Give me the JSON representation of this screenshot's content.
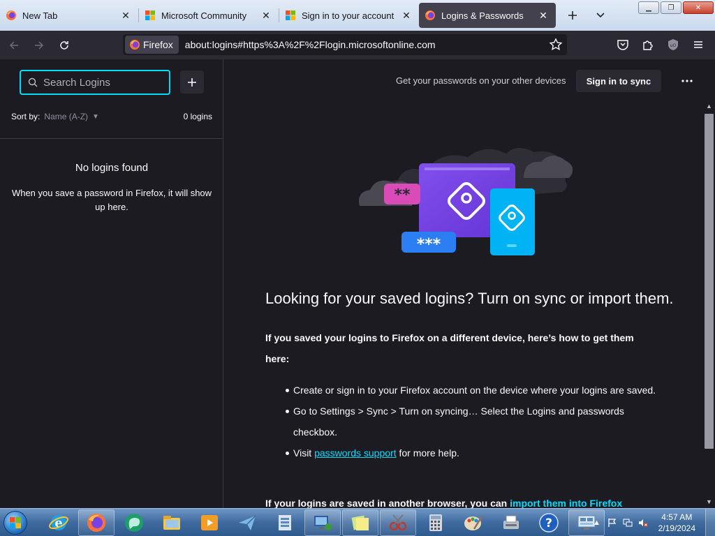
{
  "tabs": [
    {
      "title": "New Tab",
      "favicon": "firefox-icon",
      "active": false
    },
    {
      "title": "Microsoft Community",
      "favicon": "microsoft-icon",
      "active": false
    },
    {
      "title": "Sign in to your account",
      "favicon": "microsoft-icon",
      "active": false
    },
    {
      "title": "Logins & Passwords",
      "favicon": "firefox-icon",
      "active": true
    }
  ],
  "urlbar": {
    "identity_label": "Firefox",
    "url": "about:logins#https%3A%2F%2Flogin.microsoftonline.com"
  },
  "sidebar": {
    "search_placeholder": "Search Logins",
    "sort_label": "Sort by:",
    "sort_value": "Name (A-Z)",
    "count": "0 logins",
    "empty_title": "No logins found",
    "empty_text": "When you save a password in Firefox, it will show up here."
  },
  "main": {
    "sync_prompt": "Get your passwords on your other devices",
    "sync_button": "Sign in to sync",
    "headline": "Looking for your saved logins? Turn on sync or import them.",
    "lead": "If you saved your logins to Firefox on a different device, here’s how to get them here:",
    "steps": {
      "step1": "Create or sign in to your Firefox account on the device where your logins are saved.",
      "step2": "Go to Settings > Sync > Turn on syncing… Select the Logins and passwords checkbox.",
      "step3_prefix": "Visit ",
      "step3_link": "passwords support",
      "step3_suffix": " for more help."
    },
    "lead2_prefix": "If your logins are saved in another browser, you can ",
    "lead2_link": "import them into Firefox"
  },
  "taskbar": {
    "apps": [
      "internet-explorer-icon",
      "firefox-icon",
      "chat-icon",
      "file-explorer-icon",
      "media-player-icon",
      "send-icon",
      "archive-icon",
      "remote-desktop-icon",
      "sticky-notes-icon",
      "snipping-tool-icon",
      "calculator-icon",
      "paint-icon",
      "fax-scan-icon",
      "help-icon",
      "network-icon"
    ],
    "time": "4:57 AM",
    "date": "2/19/2024"
  },
  "colors": {
    "accent": "#00ddff",
    "background": "#1c1b22",
    "surface": "#2b2a33",
    "active_tab": "#42414d"
  }
}
